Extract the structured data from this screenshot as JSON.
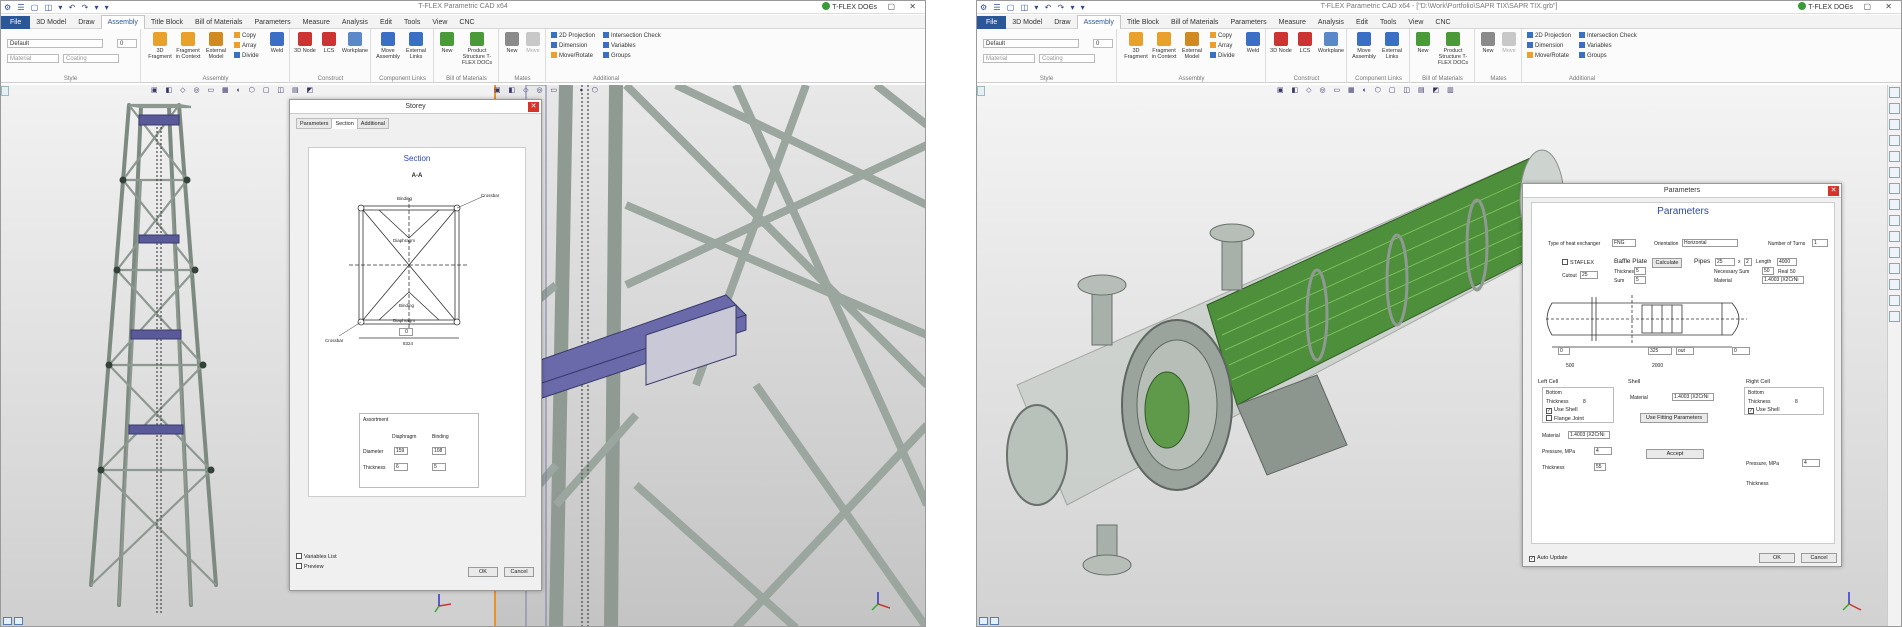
{
  "windows": [
    {
      "title": "T-FLEX Parametric CAD x64",
      "docs": "T-FLEX DOCs",
      "menu": [
        "File",
        "3D Model",
        "Draw",
        "Assembly",
        "Title Block",
        "Bill of Materials",
        "Parameters",
        "Measure",
        "Analysis",
        "Edit",
        "Tools",
        "View",
        "CNC"
      ],
      "active_menu": "Assembly",
      "ribbon": {
        "style_dropdown": "Default",
        "layer_value": "0",
        "material_dropdown": "Material",
        "coating_dropdown": "Coating",
        "style_label": "Style",
        "assembly_tools": [
          "3D Fragment",
          "Fragment in Context",
          "External Model"
        ],
        "small_tools_1": [
          "Copy",
          "Array",
          "Divide"
        ],
        "weld_label": "Weld",
        "assembly_label": "Assembly",
        "construct_tools": [
          "3D Node",
          "LCS",
          "Workplane"
        ],
        "construct_label": "Construct",
        "component_tools": [
          "Move Assembly",
          "External Links"
        ],
        "component_label": "Component Links",
        "bom_tools": [
          "New",
          "Product Structure T-FLEX DOCs"
        ],
        "bom_label": "Bill of Materials",
        "mates_tools": [
          "New",
          "Move"
        ],
        "mates_label": "Mates",
        "additional_items": [
          "2D Projection",
          "Dimension",
          "Move/Rotate",
          "Intersection Check",
          "Variables",
          "Groups"
        ],
        "additional_label": "Additional"
      }
    },
    {
      "title": "T-FLEX Parametric CAD x64 - [\"D:\\Work\\Portfolio\\SAPR TIX\\SAPR TIX.grb\"]",
      "docs": "T-FLEX DOCs"
    }
  ],
  "storey_dialog": {
    "title": "Storey",
    "tabs": [
      "Parameters",
      "Section",
      "Additional"
    ],
    "active_tab": "Section",
    "section_title": "Section",
    "section_name": "A-A",
    "drawing_labels": {
      "binding_top": "Binding",
      "crossbar_top": "Crossbar",
      "diaphragm_top": "Diaphragm",
      "binding_mid": "Binding",
      "diaphragm_mid": "Diaphragm",
      "crossbar_bottom": "Crossbar",
      "dim_zero": "0",
      "dim_bottom": "8324"
    },
    "assortment": {
      "title": "Assortment",
      "col_diaphragm": "Diaphragm",
      "col_binding": "Binding",
      "row_diameter": "Diameter",
      "row_thickness": "Thickness",
      "diameter_diaphragm": "159",
      "diameter_binding": "108",
      "thickness_diaphragm": "6",
      "thickness_binding": "5"
    },
    "variables_list": "Variables List",
    "preview": "Preview",
    "ok": "OK",
    "cancel": "Cancel"
  },
  "params_dialog": {
    "title": "Parameters",
    "heading": "Parameters",
    "type_label": "Type of heat exchanger",
    "type_value": "FNG",
    "orientation_label": "Orientation",
    "orientation_value": "Horizontal",
    "turns_label": "Number of Turns",
    "turns_value": "1",
    "stflex": "STAFLEX",
    "baffle_plate": "Baffle Plate",
    "calculate": "Calculate",
    "pipes_label": "Pipes",
    "pipes_value": "25",
    "pipes_x": "x",
    "pipes_x_value": "2",
    "length_label": "Length",
    "length_value": "4000",
    "cutout_label": "Cutout",
    "cutout_value": "25",
    "thickness_label": "Thickness",
    "thickness_value": "5",
    "sum_label": "Sum",
    "sum_value": "5",
    "necessary_sum": "Necessary Sum",
    "row_value": "50",
    "real_label": "Real",
    "real_value": "50",
    "material_label": "Material",
    "material_value": "1.4003 (X2CrNi",
    "dim_d": "325",
    "dim_out": "out",
    "dim_0": "0",
    "dim_500": "500",
    "dim_2000": "2000",
    "left_cell": "Left Cell",
    "shell": "Shell",
    "right_cell": "Right Cell",
    "bottom": "Bottom",
    "thickness_short": "Thickness",
    "left_thickness": "8",
    "use_shell": "Use Shell",
    "flange_joint": "Flange Joint",
    "shell_material": "1.4003 (X2CrNi",
    "use_fitting": "Use Fitting Parameters",
    "right_thickness": "8",
    "pressure_label": "Pressure, MPa",
    "pressure_left": "4",
    "pressure_right": "4",
    "left_material": "1.4003 (X2CrNi",
    "thickness_bottom_left": "55",
    "accept": "Accept",
    "auto_update": "Auto Update",
    "ok": "OK",
    "cancel": "Cancel"
  }
}
